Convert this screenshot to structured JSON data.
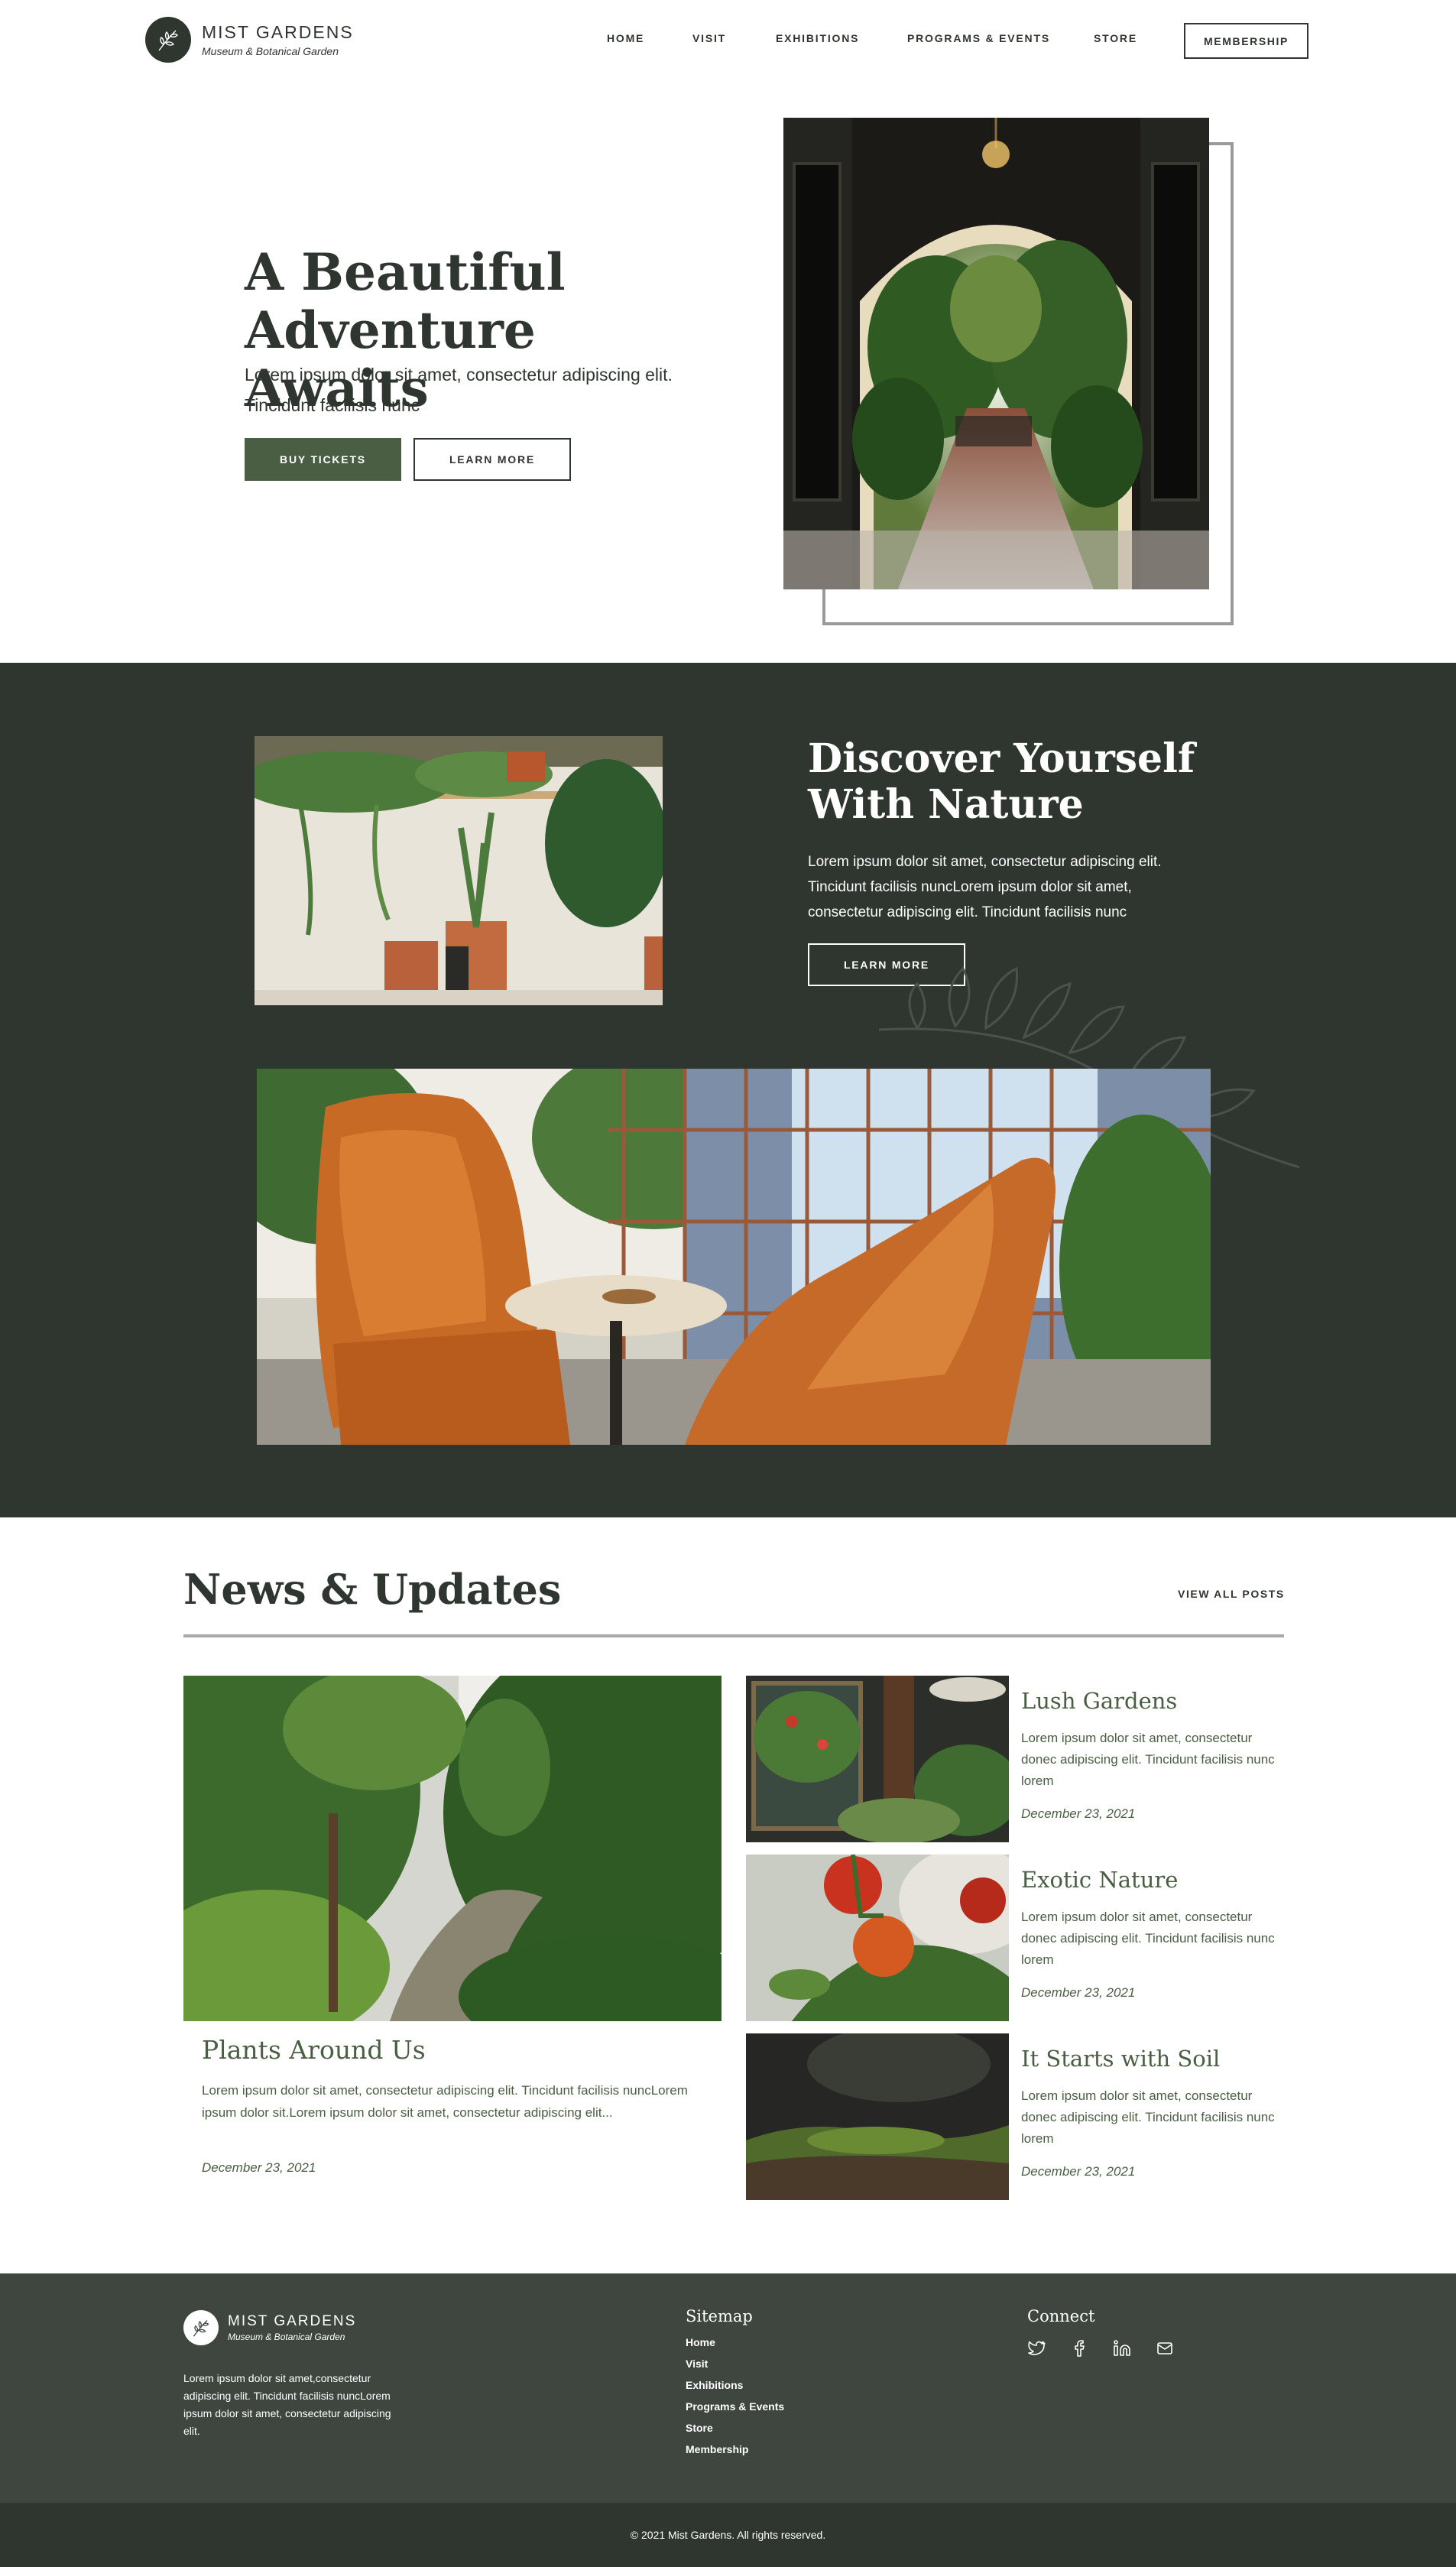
{
  "brand": {
    "name": "MIST GARDENS",
    "subtitle": "Museum & Botanical Garden"
  },
  "nav": {
    "items": [
      "HOME",
      "VISIT",
      "EXHIBITIONS",
      "PROGRAMS & EVENTS",
      "STORE"
    ],
    "membership": "MEMBERSHIP"
  },
  "hero": {
    "title": "A Beautiful Adventure Awaits",
    "text": "Lorem ipsum dolor sit amet, consectetur adipiscing elit. Tincidunt facilisis nunc",
    "buy_tickets": "BUY TICKETS",
    "learn_more": "LEARN MORE"
  },
  "discover": {
    "title": "Discover Yourself With Nature",
    "text": "Lorem ipsum dolor sit amet, consectetur adipiscing elit. Tincidunt facilisis nuncLorem ipsum dolor sit amet, consectetur adipiscing elit. Tincidunt facilisis nunc",
    "learn_more": "LEARN MORE"
  },
  "news": {
    "title": "News & Updates",
    "view_all": "VIEW ALL POSTS",
    "featured": {
      "title": "Plants Around Us",
      "text": "Lorem ipsum dolor sit amet, consectetur adipiscing elit. Tincidunt facilisis nuncLorem ipsum dolor sit.Lorem ipsum dolor sit amet, consectetur adipiscing elit...",
      "date": "December 23, 2021"
    },
    "posts": [
      {
        "title": "Lush Gardens",
        "text": "Lorem ipsum dolor sit amet, consectetur donec adipiscing elit. Tincidunt facilisis nunc lorem",
        "date": "December 23, 2021"
      },
      {
        "title": "Exotic Nature",
        "text": "Lorem ipsum dolor sit amet, consectetur donec adipiscing elit. Tincidunt facilisis nunc lorem",
        "date": "December 23, 2021"
      },
      {
        "title": "It Starts with Soil",
        "text": "Lorem ipsum dolor sit amet, consectetur donec adipiscing elit. Tincidunt facilisis nunc lorem",
        "date": "December 23, 2021"
      }
    ]
  },
  "footer": {
    "about": "Lorem ipsum dolor sit amet,consectetur adipiscing elit. Tincidunt facilisis nuncLorem ipsum dolor sit amet, consectetur adipiscing elit.",
    "sitemap_title": "Sitemap",
    "sitemap": [
      "Home",
      "Visit",
      "Exhibitions",
      "Programs & Events",
      "Store",
      "Membership"
    ],
    "connect_title": "Connect",
    "social_icons": [
      "twitter-icon",
      "facebook-icon",
      "linkedin-icon",
      "mail-icon"
    ],
    "copyright": "© 2021 Mist Gardens. All rights reserved."
  },
  "colors": {
    "dark_green": "#2f3630",
    "accent_green": "#4a5e44",
    "footer_bg": "#3e463f"
  }
}
